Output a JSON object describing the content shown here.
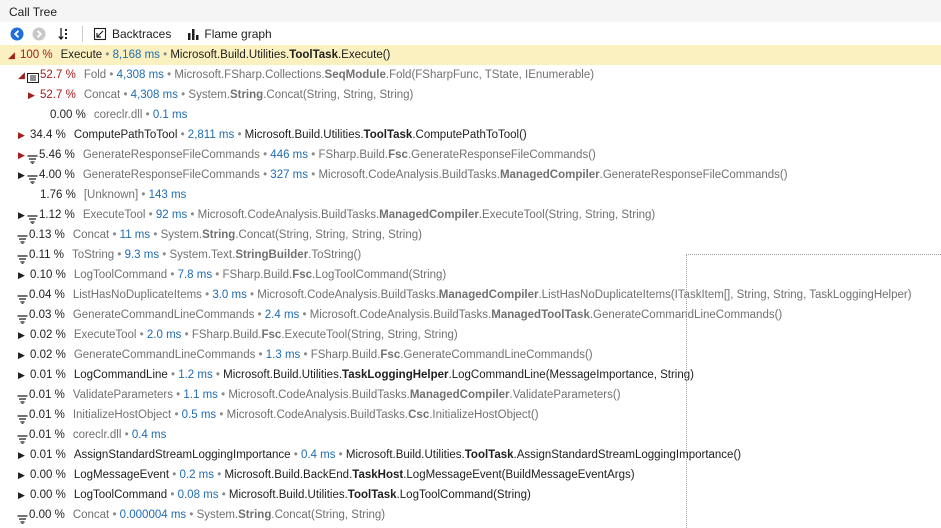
{
  "panel": {
    "title": "Call Tree"
  },
  "toolbar": {
    "backtraces_label": "Backtraces",
    "flamegraph_label": "Flame graph"
  },
  "rows": [
    {
      "indent": 0,
      "toggle": "expanded-red",
      "icon": "none",
      "pct": "100 %",
      "name": "Execute",
      "time": "8,168 ms",
      "ns": "Microsoft.Build.Utilities.",
      "cls": "ToolTask",
      "method": ".Execute()",
      "sel": true,
      "muted": false,
      "red": true
    },
    {
      "indent": 1,
      "toggle": "expanded-red",
      "icon": "fold",
      "pct": "52.7 %",
      "name": "Fold",
      "time": "4,308 ms",
      "ns": "Microsoft.FSharp.Collections.",
      "cls": "SeqModule",
      "method": ".Fold(FSharpFunc, TState, IEnumerable)",
      "muted": true,
      "red": true
    },
    {
      "indent": 2,
      "toggle": "collapsed-red",
      "icon": "none",
      "pct": "52.7 %",
      "name": "Concat",
      "time": "4,308 ms",
      "ns": "System.",
      "cls": "String",
      "method": ".Concat(String, String, String)",
      "muted": true,
      "red": true
    },
    {
      "indent": 3,
      "toggle": "none",
      "icon": "none",
      "pct": "0.00 %",
      "name": "coreclr.dll",
      "time": "0.1 ms",
      "ns": "",
      "cls": "",
      "method": "",
      "muted": true
    },
    {
      "indent": 1,
      "toggle": "collapsed-red",
      "icon": "none",
      "pct": "34.4 %",
      "name": "ComputePathToTool",
      "time": "2,811 ms",
      "ns": "Microsoft.Build.Utilities.",
      "cls": "ToolTask",
      "method": ".ComputePathToTool()",
      "muted": false
    },
    {
      "indent": 1,
      "toggle": "collapsed-red",
      "icon": "filter",
      "pct": "5.46 %",
      "name": "GenerateResponseFileCommands",
      "time": "446 ms",
      "ns": "FSharp.Build.",
      "cls": "Fsc",
      "method": ".GenerateResponseFileCommands()",
      "muted": true
    },
    {
      "indent": 1,
      "toggle": "collapsed",
      "icon": "filter",
      "pct": "4.00 %",
      "name": "GenerateResponseFileCommands",
      "time": "327 ms",
      "ns": "Microsoft.CodeAnalysis.BuildTasks.",
      "cls": "ManagedCompiler",
      "method": ".GenerateResponseFileCommands()",
      "muted": true
    },
    {
      "indent": 2,
      "toggle": "none",
      "icon": "none",
      "pct": "1.76 %",
      "name": "[Unknown]",
      "time": "143 ms",
      "ns": "",
      "cls": "",
      "method": "",
      "muted": true
    },
    {
      "indent": 1,
      "toggle": "collapsed",
      "icon": "filter",
      "pct": "1.12 %",
      "name": "ExecuteTool",
      "time": "92 ms",
      "ns": "Microsoft.CodeAnalysis.BuildTasks.",
      "cls": "ManagedCompiler",
      "method": ".ExecuteTool(String, String, String)",
      "muted": true
    },
    {
      "indent": 0,
      "toggle": "none",
      "icon": "filter",
      "pct": "0.13 %",
      "name": "Concat",
      "time": "11 ms",
      "ns": "System.",
      "cls": "String",
      "method": ".Concat(String, String, String, String)",
      "muted": true
    },
    {
      "indent": 0,
      "toggle": "none",
      "icon": "filter",
      "pct": "0.11 %",
      "name": "ToString",
      "time": "9.3 ms",
      "ns": "System.Text.",
      "cls": "StringBuilder",
      "method": ".ToString()",
      "muted": true
    },
    {
      "indent": 1,
      "toggle": "collapsed",
      "icon": "none",
      "pct": "0.10 %",
      "name": "LogToolCommand",
      "time": "7.8 ms",
      "ns": "FSharp.Build.",
      "cls": "Fsc",
      "method": ".LogToolCommand(String)",
      "muted": true
    },
    {
      "indent": 0,
      "toggle": "none",
      "icon": "filter",
      "pct": "0.04 %",
      "name": "ListHasNoDuplicateItems",
      "time": "3.0 ms",
      "ns": "Microsoft.CodeAnalysis.BuildTasks.",
      "cls": "ManagedCompiler",
      "method": ".ListHasNoDuplicateItems(ITaskItem[], String, String, TaskLoggingHelper)",
      "muted": true
    },
    {
      "indent": 0,
      "toggle": "none",
      "icon": "filter",
      "pct": "0.03 %",
      "name": "GenerateCommandLineCommands",
      "time": "2.4 ms",
      "ns": "Microsoft.CodeAnalysis.BuildTasks.",
      "cls": "ManagedToolTask",
      "method": ".GenerateCommandLineCommands()",
      "muted": true
    },
    {
      "indent": 1,
      "toggle": "collapsed",
      "icon": "none",
      "pct": "0.02 %",
      "name": "ExecuteTool",
      "time": "2.0 ms",
      "ns": "FSharp.Build.",
      "cls": "Fsc",
      "method": ".ExecuteTool(String, String, String)",
      "muted": true
    },
    {
      "indent": 1,
      "toggle": "collapsed",
      "icon": "none",
      "pct": "0.02 %",
      "name": "GenerateCommandLineCommands",
      "time": "1.3 ms",
      "ns": "FSharp.Build.",
      "cls": "Fsc",
      "method": ".GenerateCommandLineCommands()",
      "muted": true
    },
    {
      "indent": 1,
      "toggle": "collapsed",
      "icon": "none",
      "pct": "0.01 %",
      "name": "LogCommandLine",
      "time": "1.2 ms",
      "ns": "Microsoft.Build.Utilities.",
      "cls": "TaskLoggingHelper",
      "method": ".LogCommandLine(MessageImportance, String)",
      "muted": false
    },
    {
      "indent": 0,
      "toggle": "none",
      "icon": "filter",
      "pct": "0.01 %",
      "name": "ValidateParameters",
      "time": "1.1 ms",
      "ns": "Microsoft.CodeAnalysis.BuildTasks.",
      "cls": "ManagedCompiler",
      "method": ".ValidateParameters()",
      "muted": true
    },
    {
      "indent": 0,
      "toggle": "none",
      "icon": "filter",
      "pct": "0.01 %",
      "name": "InitializeHostObject",
      "time": "0.5 ms",
      "ns": "Microsoft.CodeAnalysis.BuildTasks.",
      "cls": "Csc",
      "method": ".InitializeHostObject()",
      "muted": true
    },
    {
      "indent": 0,
      "toggle": "none",
      "icon": "filter",
      "pct": "0.01 %",
      "name": "coreclr.dll",
      "time": "0.4 ms",
      "ns": "",
      "cls": "",
      "method": "",
      "muted": true
    },
    {
      "indent": 1,
      "toggle": "collapsed",
      "icon": "none",
      "pct": "0.01 %",
      "name": "AssignStandardStreamLoggingImportance",
      "time": "0.4 ms",
      "ns": "Microsoft.Build.Utilities.",
      "cls": "ToolTask",
      "method": ".AssignStandardStreamLoggingImportance()",
      "muted": false
    },
    {
      "indent": 1,
      "toggle": "collapsed",
      "icon": "none",
      "pct": "0.00 %",
      "name": "LogMessageEvent",
      "time": "0.2 ms",
      "ns": "Microsoft.Build.BackEnd.",
      "cls": "TaskHost",
      "method": ".LogMessageEvent(BuildMessageEventArgs)",
      "muted": false
    },
    {
      "indent": 1,
      "toggle": "collapsed",
      "icon": "none",
      "pct": "0.00 %",
      "name": "LogToolCommand",
      "time": "0.08 ms",
      "ns": "Microsoft.Build.Utilities.",
      "cls": "ToolTask",
      "method": ".LogToolCommand(String)",
      "muted": false
    },
    {
      "indent": 0,
      "toggle": "none",
      "icon": "filter",
      "pct": "0.00 %",
      "name": "Concat",
      "time": "0.000004 ms",
      "ns": "System.",
      "cls": "String",
      "method": ".Concat(String, String)",
      "muted": true
    }
  ],
  "separator": " • "
}
